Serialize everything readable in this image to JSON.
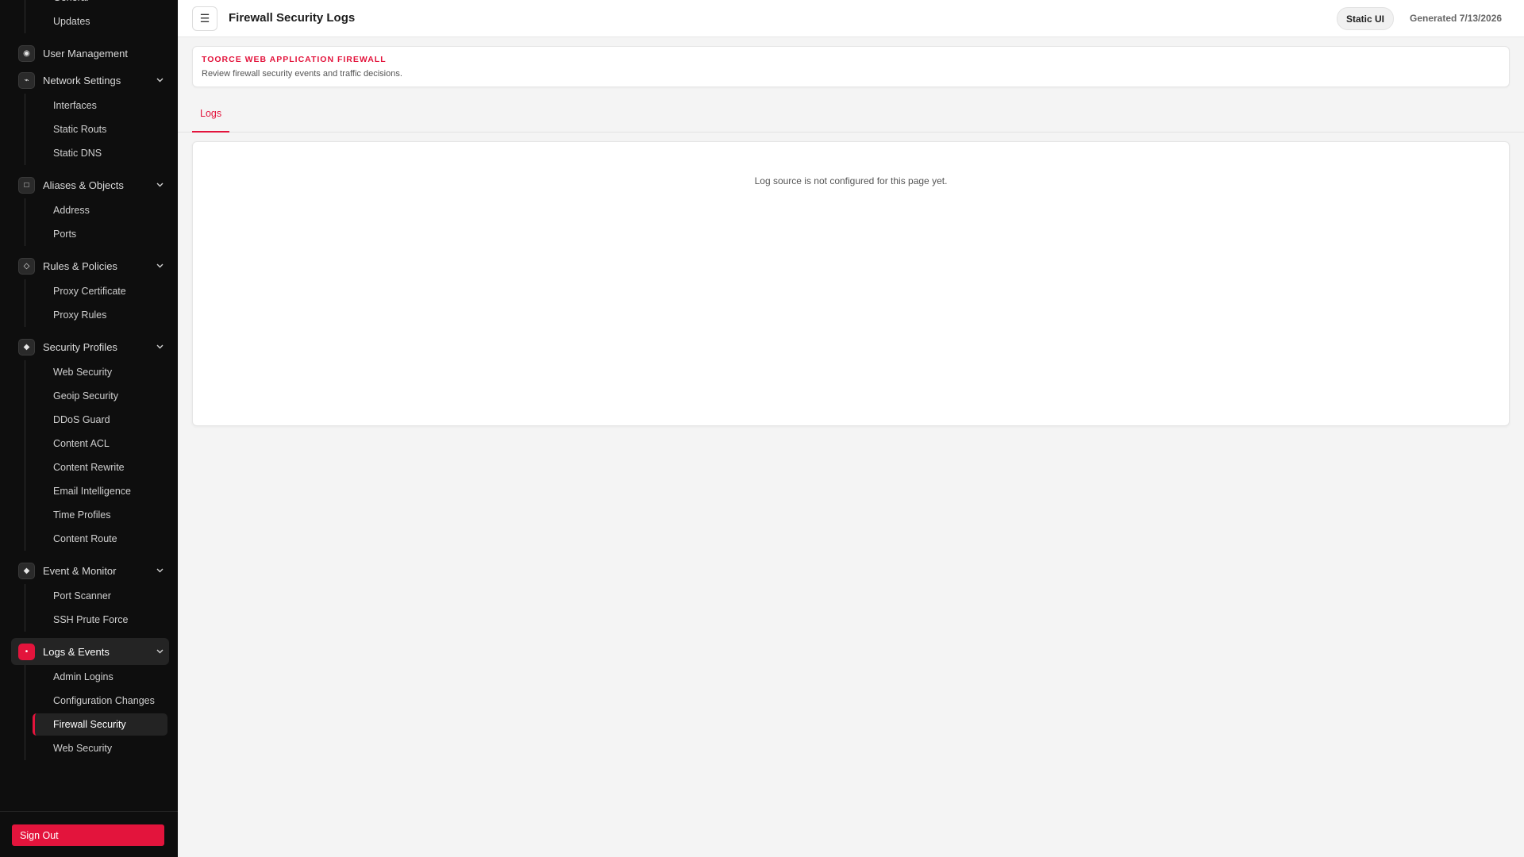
{
  "sidebar": {
    "top_items": [
      "General",
      "Updates"
    ],
    "groups": [
      {
        "label": "User Management",
        "icon": "user-circle-icon",
        "glyph": "◉",
        "items": []
      },
      {
        "label": "Network Settings",
        "icon": "network-icon",
        "glyph": "⌁",
        "items": [
          "Interfaces",
          "Static Routs",
          "Static DNS"
        ]
      },
      {
        "label": "Aliases & Objects",
        "icon": "square-icon",
        "glyph": "□",
        "items": [
          "Address",
          "Ports"
        ]
      },
      {
        "label": "Rules & Policies",
        "icon": "diamond-outline-icon",
        "glyph": "◇",
        "items": [
          "Proxy Certificate",
          "Proxy Rules"
        ]
      },
      {
        "label": "Security Profiles",
        "icon": "diamond-icon",
        "glyph": "◆",
        "items": [
          "Web Security",
          "Geoip Security",
          "DDoS Guard",
          "Content ACL",
          "Content Rewrite",
          "Email Intelligence",
          "Time Profiles",
          "Content Route"
        ]
      },
      {
        "label": "Event & Monitor",
        "icon": "diamond-icon",
        "glyph": "◆",
        "items": [
          "Port Scanner",
          "SSH Prute Force"
        ]
      },
      {
        "label": "Logs & Events",
        "icon": "dot-icon",
        "glyph": "•",
        "items": [
          "Admin Logins",
          "Configuration Changes",
          "Firewall Security",
          "Web Security"
        ],
        "active": true,
        "active_item": "Firewall Security"
      }
    ],
    "sign_out_label": "Sign Out"
  },
  "topbar": {
    "menu_glyph": "☰",
    "title": "Firewall Security Logs",
    "badge": "Static UI",
    "generated": "Generated 7/13/2026"
  },
  "banner": {
    "title": "TOORCE WEB APPLICATION FIREWALL",
    "description": "Review firewall security events and traffic decisions."
  },
  "tabs": [
    {
      "label": "Logs",
      "active": true
    }
  ],
  "panel": {
    "empty_message": "Log source is not configured for this page yet."
  },
  "colors": {
    "accent": "#e3143c",
    "sidebar_bg": "#0e0e0e",
    "page_bg": "#f4f4f4"
  }
}
